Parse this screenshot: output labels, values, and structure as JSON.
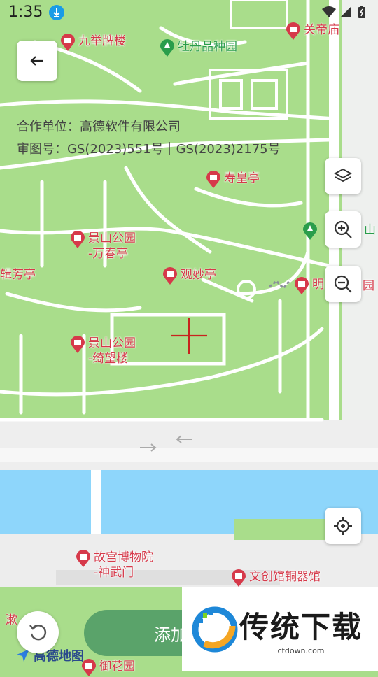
{
  "status": {
    "time": "1:35"
  },
  "copyright": {
    "line1": "合作单位：高德软件有限公司",
    "line2": "审图号：GS(2023)551号｜GS(2023)2175号"
  },
  "pois": {
    "jiujupailou": "九举牌楼",
    "mudanpinzhongyuan": "牡丹品种园",
    "guandimiao": "关帝庙",
    "shouhuangting": "寿皇亭",
    "jingshan_wanchun_1": "景山公园",
    "jingshan_wanchun_2": "-万春亭",
    "jifangting": "辑芳亭",
    "guanmiaoting": "观妙亭",
    "ming_park": "明",
    "ming_park_tail": "园",
    "shan_label": "山",
    "jingshan_qiwang_1": "景山公园",
    "jingshan_qiwang_2": "-绮望楼",
    "gugong_1": "故宫博物院",
    "gugong_2": "-神武门",
    "wenchuang": "文创馆铜器馆",
    "yuhuayuan": "御花园",
    "shu_left": "漱"
  },
  "bottom": {
    "add_label": "添加",
    "map_logo": "高德地图"
  },
  "watermark": {
    "title": "传统下载",
    "url": "ctdown.com"
  },
  "colors": {
    "park_green": "#a9dd8b",
    "water_blue": "#8ed6fb",
    "poi_red": "#d6394a",
    "button_green": "#5aa36a"
  }
}
